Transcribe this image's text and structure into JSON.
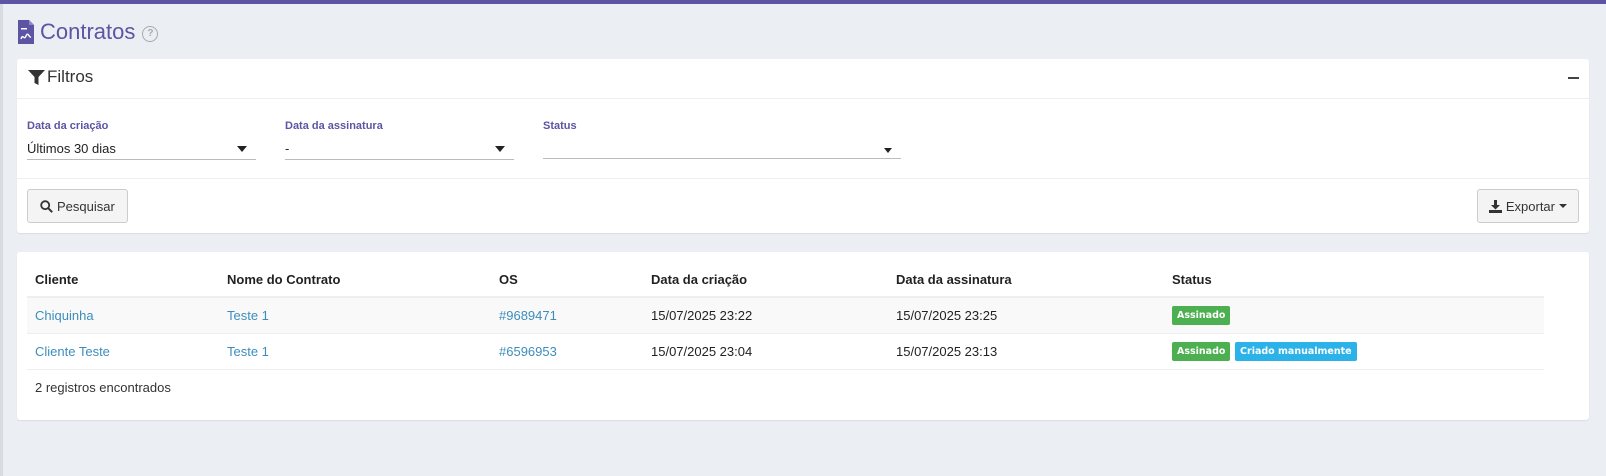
{
  "page": {
    "title": "Contratos",
    "help_glyph": "?"
  },
  "filters": {
    "title": "Filtros",
    "fields": [
      {
        "label": "Data da criação",
        "value": "Últimos 30 dias"
      },
      {
        "label": "Data da assinatura",
        "value": "-"
      },
      {
        "label": "Status",
        "value": ""
      }
    ],
    "search_label": "Pesquisar",
    "export_label": "Exportar"
  },
  "table": {
    "headers": [
      "Cliente",
      "Nome do Contrato",
      "OS",
      "Data da criação",
      "Data da assinatura",
      "Status"
    ],
    "rows": [
      {
        "cliente": "Chiquinha",
        "contrato": "Teste 1",
        "os": "#9689471",
        "criacao": "15/07/2025 23:22",
        "assinatura": "15/07/2025 23:25",
        "badges": [
          "Assinado"
        ]
      },
      {
        "cliente": "Cliente Teste",
        "contrato": "Teste 1",
        "os": "#6596953",
        "criacao": "15/07/2025 23:04",
        "assinatura": "15/07/2025 23:13",
        "badges": [
          "Assinado",
          "Criado manualmente"
        ]
      }
    ],
    "records_text": "2 registros encontrados"
  },
  "colors": {
    "brand": "#5b55a3",
    "link": "#3c8dbc",
    "badge_signed": "#4caf50",
    "badge_manual": "#2bb3e9"
  },
  "icons": {
    "page": "file-contract-icon",
    "help": "question-circle-icon",
    "filter": "filter-icon",
    "collapse": "minus-icon",
    "search": "search-icon",
    "export": "download-icon"
  }
}
